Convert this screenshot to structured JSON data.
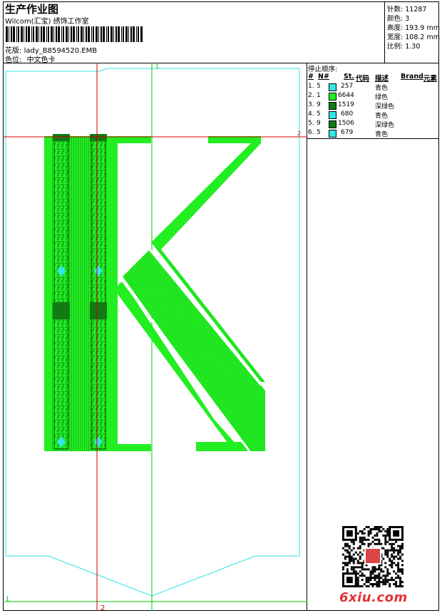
{
  "header": {
    "title": "生产作业图",
    "company": "Wilcom(汇宝) 绣饰工作室",
    "design_label": "花版:",
    "design_value": "lady_B8594520.EMB",
    "colorpos_label": "色位:",
    "colorpos_value": "中文色卡"
  },
  "stats": [
    {
      "label": "针数:",
      "value": "11287"
    },
    {
      "label": "颜色:",
      "value": "3"
    },
    {
      "label": "高度:",
      "value": "193.9 mm"
    },
    {
      "label": "宽度:",
      "value": "108.2 mm"
    },
    {
      "label": "比例:",
      "value": "1.30"
    }
  ],
  "stop_sequence": {
    "title": "停止顺序:",
    "headers": {
      "num": "#",
      "n": "N#",
      "st": "St.",
      "code": "代码",
      "desc": "描述",
      "brand": "Brand",
      "element": "元素"
    },
    "rows": [
      {
        "num": "1.",
        "n": "5",
        "color": "#33e6e6",
        "code": "257",
        "desc": "青色"
      },
      {
        "num": "2.",
        "n": "1",
        "color": "#22ee22",
        "code": "6644",
        "desc": "绿色"
      },
      {
        "num": "3.",
        "n": "9",
        "color": "#127a12",
        "code": "1519",
        "desc": "深绿色"
      },
      {
        "num": "4.",
        "n": "5",
        "color": "#33e6e6",
        "code": "680",
        "desc": "青色"
      },
      {
        "num": "5.",
        "n": "9",
        "color": "#127a12",
        "code": "1506",
        "desc": "深绿色"
      },
      {
        "num": "6.",
        "n": "5",
        "color": "#33e6e6",
        "code": "679",
        "desc": "青色"
      }
    ]
  },
  "guides": {
    "top1": "1",
    "right2": "2",
    "left1": "1",
    "bottom2": "2"
  },
  "colors": {
    "green": "#22ee22",
    "dark_green": "#127a12",
    "cyan": "#33e6e6",
    "red_guide": "#cc0000",
    "green_guide": "#00cc00"
  },
  "watermark": {
    "site": "6xiu.com"
  }
}
